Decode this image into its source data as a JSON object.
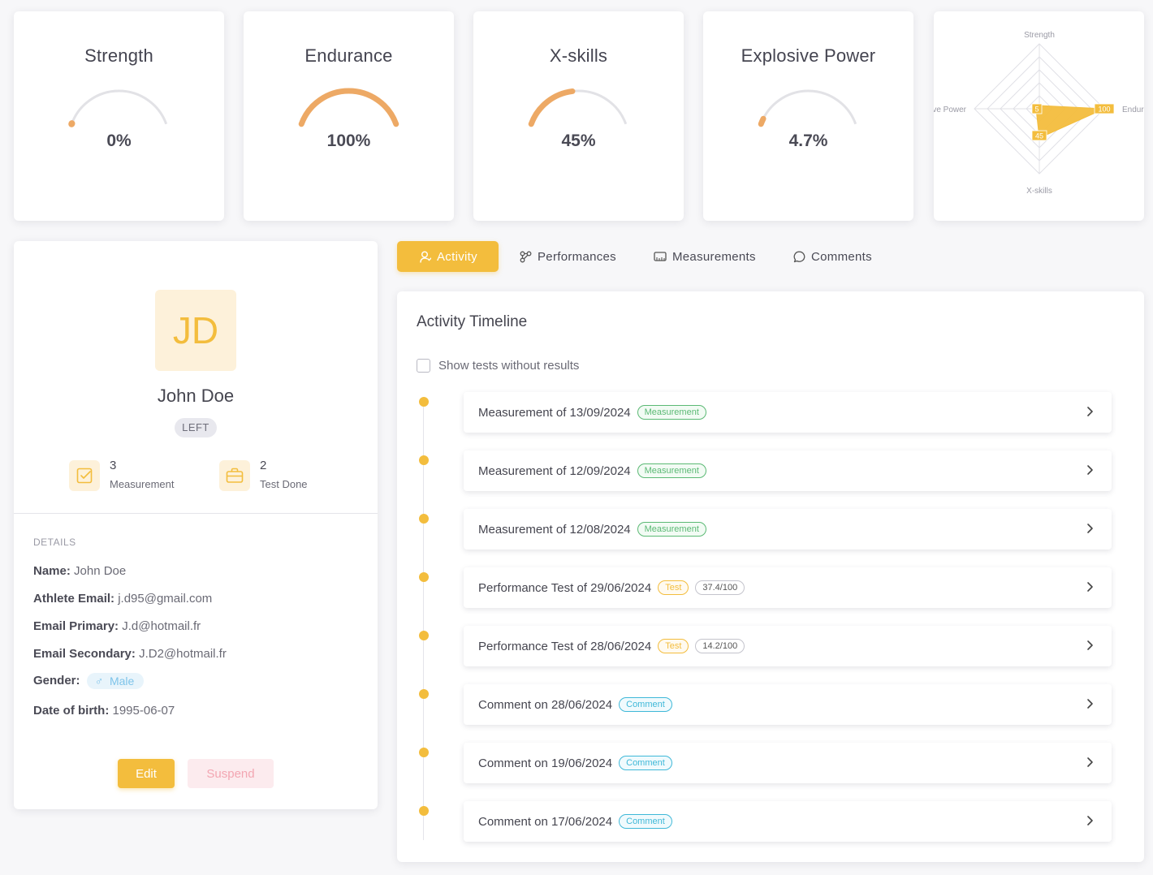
{
  "stats": [
    {
      "title": "Strength",
      "value_text": "0%",
      "level": 0
    },
    {
      "title": "Endurance",
      "value_text": "100%",
      "level": 100
    },
    {
      "title": "X-skills",
      "value_text": "45%",
      "level": 45
    },
    {
      "title": "Explosive Power",
      "value_text": "4.7%",
      "level": 4.7
    }
  ],
  "radar": {
    "axes": [
      "Strength",
      "Endurance",
      "X-skills",
      "sive Power"
    ],
    "values": [
      5,
      100,
      45,
      5
    ],
    "max": 100,
    "value_labels": [
      "5",
      "100",
      "45"
    ],
    "fill_color": "#f3bd3d"
  },
  "profile": {
    "initials": "JD",
    "name": "John Doe",
    "side": "LEFT",
    "stats": [
      {
        "count": "3",
        "label": "Measurement",
        "icon": "checkbox-icon"
      },
      {
        "count": "2",
        "label": "Test Done",
        "icon": "briefcase-icon"
      }
    ],
    "details_title": "DETAILS",
    "details": [
      {
        "label": "Name:",
        "value": "John Doe"
      },
      {
        "label": "Athlete Email:",
        "value": "j.d95@gmail.com"
      },
      {
        "label": "Email Primary:",
        "value": "J.d@hotmail.fr"
      },
      {
        "label": "Email Secondary:",
        "value": "J.D2@hotmail.fr"
      }
    ],
    "gender_label": "Gender:",
    "gender_value": "Male",
    "dob_label": "Date of birth:",
    "dob_value": "1995-06-07",
    "edit_label": "Edit",
    "suspend_label": "Suspend"
  },
  "tabs": [
    {
      "label": "Activity",
      "icon": "user-icon",
      "active": true
    },
    {
      "label": "Performances",
      "icon": "nodes-icon",
      "active": false
    },
    {
      "label": "Measurements",
      "icon": "ruler-icon",
      "active": false
    },
    {
      "label": "Comments",
      "icon": "chat-icon",
      "active": false
    }
  ],
  "timeline": {
    "title": "Activity Timeline",
    "checkbox_label": "Show tests without results",
    "checkbox_checked": false,
    "items": [
      {
        "text": "Measurement of 13/09/2024",
        "tag": "Measurement",
        "tag_type": "measurement",
        "score": ""
      },
      {
        "text": "Measurement of 12/09/2024",
        "tag": "Measurement",
        "tag_type": "measurement",
        "score": ""
      },
      {
        "text": "Measurement of 12/08/2024",
        "tag": "Measurement",
        "tag_type": "measurement",
        "score": ""
      },
      {
        "text": "Performance Test of 29/06/2024",
        "tag": "Test",
        "tag_type": "test",
        "score": "37.4/100"
      },
      {
        "text": "Performance Test of 28/06/2024",
        "tag": "Test",
        "tag_type": "test",
        "score": "14.2/100"
      },
      {
        "text": "Comment on 28/06/2024",
        "tag": "Comment",
        "tag_type": "comment",
        "score": ""
      },
      {
        "text": "Comment on 19/06/2024",
        "tag": "Comment",
        "tag_type": "comment",
        "score": ""
      },
      {
        "text": "Comment on 17/06/2024",
        "tag": "Comment",
        "tag_type": "comment",
        "score": ""
      }
    ]
  },
  "colors": {
    "accent": "#f3bd3d",
    "gauge_fill": "#eda965",
    "gauge_track": "#e2e2e6"
  }
}
